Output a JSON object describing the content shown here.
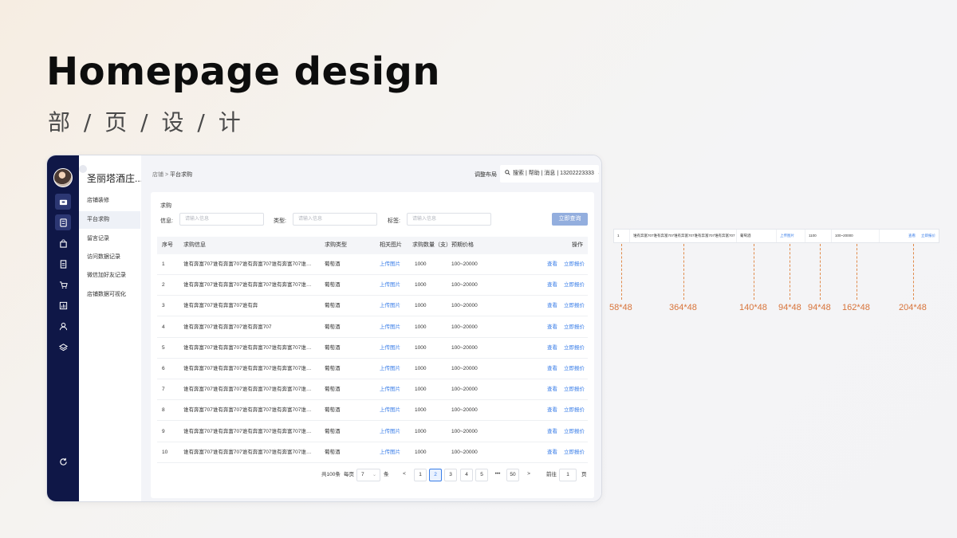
{
  "headline": "Homepage design",
  "subheadline": "部 / 页 / 设  / 计",
  "app": {
    "store_name": "圣丽塔酒庄...",
    "menu": [
      "店铺装修",
      "平台求购",
      "留言记录",
      "访问数据记录",
      "微信加好友记录",
      "店铺数据可视化"
    ],
    "active_menu_index": 1,
    "breadcrumb": {
      "root": "店铺",
      "separator": ">",
      "current": "平台求购"
    },
    "top_link": "调整布局",
    "top_search_text": "搜索 | 帮助 | 消息 | 13202223333",
    "top_search_caret": "⌄",
    "panel_title": "求购",
    "filters": [
      {
        "label": "信息:",
        "placeholder": "请输入信息"
      },
      {
        "label": "类型:",
        "placeholder": "请输入信息"
      },
      {
        "label": "标签:",
        "placeholder": "请输入信息"
      }
    ],
    "query_button": "立即查询",
    "columns": [
      "序号",
      "求购信息",
      "求购类型",
      "相关图片",
      "求购数量（支）",
      "预期价格",
      "操作"
    ],
    "rows": [
      {
        "no": "1",
        "info": "谁有奔富707谁有奔富707谁有奔富707谁有奔富707谁有奔富707谁有奔富707",
        "type": "葡萄酒",
        "image": "上传图片",
        "qty": "1000",
        "price": "100~20000",
        "view": "查看",
        "quote": "立即报价"
      },
      {
        "no": "2",
        "info": "谁有奔富707谁有奔富707谁有奔富707谁有奔富707谁有奔富707谁有奔富707",
        "type": "葡萄酒",
        "image": "上传图片",
        "qty": "1000",
        "price": "100~20000",
        "view": "查看",
        "quote": "立即报价"
      },
      {
        "no": "3",
        "info": "谁有奔富707谁有奔富707谁有奔",
        "type": "葡萄酒",
        "image": "上传图片",
        "qty": "1000",
        "price": "100~20000",
        "view": "查看",
        "quote": "立即报价"
      },
      {
        "no": "4",
        "info": "谁有奔富707谁有奔富707谁有奔富707",
        "type": "葡萄酒",
        "image": "上传图片",
        "qty": "1000",
        "price": "100~20000",
        "view": "查看",
        "quote": "立即报价"
      },
      {
        "no": "5",
        "info": "谁有奔富707谁有奔富707谁有奔富707谁有奔富707谁有奔富707谁有奔富707",
        "type": "葡萄酒",
        "image": "上传图片",
        "qty": "1000",
        "price": "100~20000",
        "view": "查看",
        "quote": "立即报价"
      },
      {
        "no": "6",
        "info": "谁有奔富707谁有奔富707谁有奔富707谁有奔富707谁有奔富707谁有奔富707",
        "type": "葡萄酒",
        "image": "上传图片",
        "qty": "1000",
        "price": "100~20000",
        "view": "查看",
        "quote": "立即报价"
      },
      {
        "no": "7",
        "info": "谁有奔富707谁有奔富707谁有奔富707谁有奔富707谁有奔富707谁有奔富707",
        "type": "葡萄酒",
        "image": "上传图片",
        "qty": "1000",
        "price": "100~20000",
        "view": "查看",
        "quote": "立即报价"
      },
      {
        "no": "8",
        "info": "谁有奔富707谁有奔富707谁有奔富707谁有奔富707谁有奔富707谁有奔富707",
        "type": "葡萄酒",
        "image": "上传图片",
        "qty": "1000",
        "price": "100~20000",
        "view": "查看",
        "quote": "立即报价"
      },
      {
        "no": "9",
        "info": "谁有奔富707谁有奔富707谁有奔富707谁有奔富707谁有奔富707谁有奔富707",
        "type": "葡萄酒",
        "image": "上传图片",
        "qty": "1000",
        "price": "100~20000",
        "view": "查看",
        "quote": "立即报价"
      },
      {
        "no": "10",
        "info": "谁有奔富707谁有奔富707谁有奔富707谁有奔富707谁有奔富707谁有奔富707",
        "type": "葡萄酒",
        "image": "上传图片",
        "qty": "1000",
        "price": "100~20000",
        "view": "查看",
        "quote": "立即报价"
      }
    ],
    "pagination": {
      "total": "共100条",
      "per_page_label": "每页",
      "per_page_value": "7",
      "per_page_unit": "条",
      "prev": "<",
      "pages": [
        "1",
        "2",
        "3",
        "4",
        "5"
      ],
      "current": "2",
      "ellipsis": "•••",
      "last": "50",
      "next": ">",
      "goto_label": "前往",
      "goto_value": "1",
      "goto_unit": "页"
    },
    "rail_icons": [
      "store-icon",
      "calculator-icon",
      "bag-icon",
      "document-icon",
      "cart-icon",
      "chart-icon",
      "user-icon",
      "layers-icon",
      "refresh-icon"
    ]
  },
  "spec": {
    "row": {
      "no": "1",
      "info": "谁有奔富707谁有奔富707谁有奔富707谁有奔富707谁有奔富707",
      "type": "葡萄酒",
      "image": "上传图片",
      "qty": "1100",
      "price": "100~20000",
      "view": "查看",
      "quote": "立即报价"
    },
    "sizes": [
      "58*48",
      "364*48",
      "140*48",
      "94*48",
      "94*48",
      "162*48",
      "204*48"
    ]
  },
  "colors": {
    "rail": "#0f1747",
    "link": "#3a7ee8",
    "query_button": "#93aede",
    "annotation": "#d8743a"
  }
}
